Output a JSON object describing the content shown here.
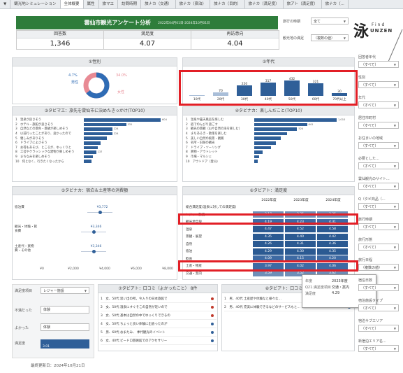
{
  "tabs": [
    "▼",
    "観光地シミュレーション",
    "全体概要",
    "属性",
    "旅マエ",
    "訪問時期",
    "旅ナカ（交通）",
    "旅ナカ（宿泊）",
    "旅ナカ（目的）",
    "旅ナカ（満足度）",
    "旅アト（満足度）",
    "旅ナカ（..."
  ],
  "active_tab": 2,
  "header": {
    "title": "雲仙市観光アンケート分析",
    "period": "2022年04月01日-2024年10月01日"
  },
  "kpis": [
    {
      "label": "回答数",
      "value": "1,346"
    },
    {
      "label": "満足度",
      "value": "4.07"
    },
    {
      "label": "再訪意向",
      "value": "4.04"
    }
  ],
  "top_filters": [
    {
      "label": "旅行の時期",
      "value": "全て"
    },
    {
      "label": "観光地の満足",
      "value": "（複数の値）"
    }
  ],
  "logo": {
    "kanji": "泳",
    "line1": "Find",
    "line2": "UNZEN"
  },
  "gender": {
    "title": "①性別",
    "male_pct": "64.4%",
    "male_label": "男性",
    "female_pct": "34.0%",
    "female_label": "女性",
    "other_pct": "4.7%",
    "colors": {
      "male": "#2f6cb5",
      "female": "#e88a94"
    }
  },
  "age": {
    "title": "②年代",
    "columns": [
      {
        "label": "10代",
        "value": "",
        "bar": 0.01
      },
      {
        "label": "20代",
        "value": "70",
        "bar": 0.22
      },
      {
        "label": "30代",
        "value": "220",
        "bar": 0.67
      },
      {
        "label": "40代",
        "value": "317",
        "bar": 0.85
      },
      {
        "label": "50代",
        "value": "432",
        "bar": 1.0
      },
      {
        "label": "60代",
        "value": "321",
        "bar": 0.8
      },
      {
        "label": "70代以上",
        "value": "30",
        "bar": 0.18
      }
    ]
  },
  "motive": {
    "title": "③タビマエ：旅先を雲仙市に決めたきっかけ(TOP10)",
    "rows": [
      {
        "label": "1　温泉が良さそう",
        "value": "604",
        "ratio": 1.0
      },
      {
        "label": "2　ホテル・旅館が良さそう",
        "value": "331",
        "ratio": 0.55
      },
      {
        "label": "3　自然などの景色・景観が楽しめそう",
        "value": "224",
        "ratio": 0.37
      },
      {
        "label": "4　以前行ったことがあり、良かったので",
        "value": "224",
        "ratio": 0.37
      },
      {
        "label": "5　親しみがありそう",
        "value": "",
        "ratio": 0.3
      },
      {
        "label": "6　ドライブによさそう",
        "value": "",
        "ratio": 0.22
      },
      {
        "label": "7　お得もあそび、ところが、ゆっくりと",
        "value": "",
        "ratio": 0.18
      },
      {
        "label": "8　工芸やクラッシックな建物が楽しめそう",
        "value": "137",
        "ratio": 0.16
      },
      {
        "label": "9　まちなみを楽しめそう",
        "value": "",
        "ratio": 0.12
      },
      {
        "label": "10　何となく、行きたくなったから",
        "value": "",
        "ratio": 0.1
      }
    ]
  },
  "enjoy": {
    "title": "④タビナカ：楽しんだこと(TOP10)",
    "rows": [
      {
        "label": "1　温泉や露天風呂を楽しむ",
        "value": "1,010",
        "ratio": 1.0
      },
      {
        "label": "2　宿でのんびり過ごす",
        "value": "641",
        "ratio": 0.64
      },
      {
        "label": "3　観光の景観（山や自然の海を楽しむ）",
        "value": "524",
        "ratio": 0.52
      },
      {
        "label": "4　まちあるき・散策を楽しむ",
        "value": "",
        "ratio": 0.4
      },
      {
        "label": "5　美しい自然の風景・観賞",
        "value": "",
        "ratio": 0.32
      },
      {
        "label": "6　名所・旧跡の観光",
        "value": "",
        "ratio": 0.26
      },
      {
        "label": "7　ドライブ・ツーリング",
        "value": "",
        "ratio": 0.2
      },
      {
        "label": "8　買物・アウトレット",
        "value": "",
        "ratio": 0.1
      },
      {
        "label": "9　市場・マルシェ",
        "value": "",
        "ratio": 0.06
      },
      {
        "label": "10　アウトドア（登山）",
        "value": "",
        "ratio": 0.04
      }
    ]
  },
  "spend": {
    "title": "⑤タビナカ：宿泊＆土産等の消費額",
    "rows": [
      {
        "label": "宿泊費",
        "value": "¥3,772",
        "ratio": 0.47
      },
      {
        "label": "観光・体験・飲食費",
        "value": "¥3,346",
        "ratio": 0.42
      },
      {
        "label": "土産代・買物費・その他",
        "value": "¥3,346",
        "ratio": 0.42
      }
    ],
    "axis": [
      "¥0",
      "¥2,000",
      "¥4,000",
      "¥6,000",
      "¥8,000"
    ]
  },
  "satisfaction": {
    "title": "⑥タビアト：満足度",
    "years": [
      "2022年度",
      "2023年度",
      "2024年度"
    ],
    "rows": [
      {
        "label": "総合満足度(温泉に対しての満足度)",
        "values": [
          "",
          "",
          ""
        ],
        "shade": 0
      },
      {
        "label": "レジャー施設",
        "values": [
          "3.17",
          "3.35",
          "3.35"
        ],
        "shade": 1
      },
      {
        "label": "観光地全般",
        "values": [
          "4.19",
          "4.23",
          "4.31"
        ],
        "shade": 2
      },
      {
        "label": "温泉",
        "values": [
          "4.47",
          "4.52",
          "4.58"
        ],
        "shade": 3
      },
      {
        "label": "景観・展望",
        "values": [
          "4.35",
          "4.40",
          "4.42"
        ],
        "shade": 3
      },
      {
        "label": "自然",
        "values": [
          "4.26",
          "4.31",
          "4.36"
        ],
        "shade": 3
      },
      {
        "label": "宿泊",
        "values": [
          "4.29",
          "4.30",
          "4.35"
        ],
        "shade": 3
      },
      {
        "label": "飲食",
        "values": [
          "4.09",
          "4.15",
          "4.20"
        ],
        "shade": 2
      },
      {
        "label": "土産・物産",
        "values": [
          "3.97",
          "4.02",
          "4.06"
        ],
        "shade": 2
      },
      {
        "label": "交通・案内",
        "values": [
          "3.59",
          "3.52",
          "3.62"
        ],
        "shade": 1
      }
    ]
  },
  "bottom_left": {
    "filter_label": "満足度項目",
    "filter_value": "レジャー施設",
    "fields": [
      {
        "label": "不満だった",
        "value": "体験"
      },
      {
        "label": "よかった",
        "value": "体験"
      },
      {
        "label": "満足度",
        "value": "3.01"
      }
    ]
  },
  "reviews_good": {
    "title": "⑦タビアト：口コミ（よかったこと）",
    "count": "8件",
    "rows": [
      {
        "text": "1　女、50代 思い出の所。今入りの日本旅館で",
        "color": "#c0392b"
      },
      {
        "text": "2　女、50代 温泉にすぐそこの自然が近いので",
        "color": "#c0392b"
      },
      {
        "text": "3　女、50代 基本は自然の中でゆっくりできるの",
        "color": "#c0392b"
      },
      {
        "text": "4　女、50代 ちょっと良い体験に出会ったのが",
        "color": "#2f5f98"
      },
      {
        "text": "5　男、60代 おまたみ、 季代観光のイベント",
        "color": "#2f5f98"
      },
      {
        "text": "6　女、40代 ビードロ芸術館でのアクセサリー",
        "color": "#2f5f98"
      }
    ]
  },
  "reviews_bad": {
    "title": "⑧タビアト：口コミ（ク",
    "rows": [
      {
        "text": "1　男、40代 土産屋や体験なと様々な…",
        "color": "#c0392b"
      },
      {
        "text": "2　男、40代 充実に体験できるなどのサービスもと…",
        "color": "#2f5f98"
      }
    ]
  },
  "tooltip": {
    "rows": [
      {
        "k": "年度",
        "v": "2023年度"
      },
      {
        "k": "Q21.満足度項目",
        "v": "交通・案内"
      },
      {
        "k": "満足度",
        "v": "4.29"
      }
    ]
  },
  "sidebar": [
    {
      "label": "回答者年代",
      "value": "（すべて）"
    },
    {
      "label": "性別",
      "value": "（すべて）"
    },
    {
      "label": "年代",
      "value": "（すべて）"
    },
    {
      "label": "居住市町村",
      "value": "（すべて）"
    },
    {
      "label": "お住まいの地域",
      "value": "（すべて）"
    },
    {
      "label": "必要とした...",
      "value": "（すべて）"
    },
    {
      "label": "雲仙観光のサイト...",
      "value": "（すべて）"
    },
    {
      "label": "Q（タビ商品（...",
      "value": "（すべて）"
    },
    {
      "label": "旅行時期",
      "value": "（すべて）"
    },
    {
      "label": "旅行形態",
      "value": "（すべて）"
    },
    {
      "label": "旅行日程",
      "value": "（複数の値）"
    },
    {
      "label": "宿泊日数",
      "value": "（すべて）"
    },
    {
      "label": "宿泊施設タイプ",
      "value": "（すべて）"
    },
    {
      "label": "宿泊サブエリア",
      "value": "（すべて）"
    },
    {
      "label": "新宿泊エリア名...",
      "value": "（すべて）"
    }
  ],
  "footer": "最終更新日：2024年10月21日"
}
